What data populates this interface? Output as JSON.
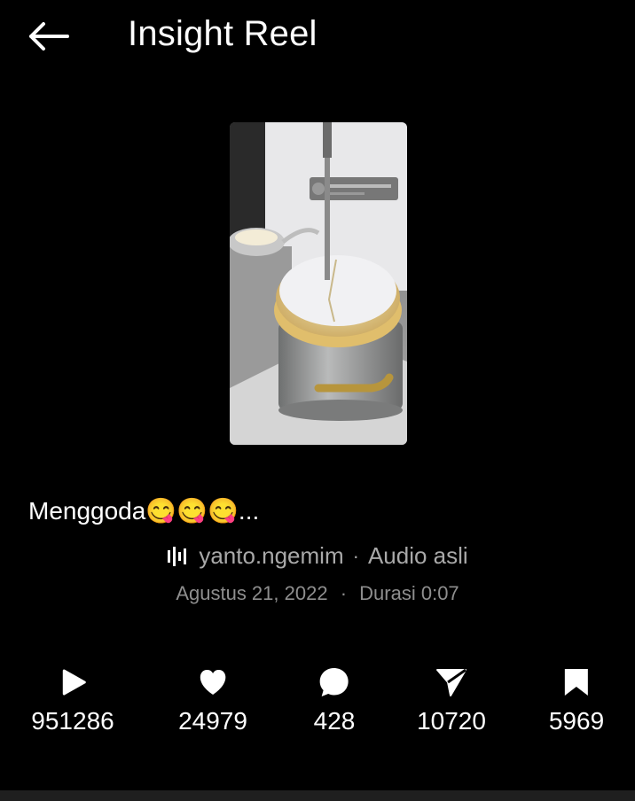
{
  "header": {
    "title": "Insight Reel",
    "back_icon": "arrow-left-icon"
  },
  "reel": {
    "thumbnail": "soufflé-video-thumbnail",
    "caption": "Menggoda😋😋😋..."
  },
  "audio": {
    "icon": "audio-waveform-icon",
    "username": "yanto.ngemim",
    "separator": "·",
    "label": "Audio asli"
  },
  "meta": {
    "date": "Agustus 21, 2022",
    "separator": "·",
    "duration": "Durasi 0:07"
  },
  "stats": {
    "plays": {
      "icon": "play-icon",
      "value": "951286"
    },
    "likes": {
      "icon": "heart-icon",
      "value": "24979"
    },
    "comments": {
      "icon": "comment-icon",
      "value": "428"
    },
    "shares": {
      "icon": "send-icon",
      "value": "10720"
    },
    "saves": {
      "icon": "bookmark-icon",
      "value": "5969"
    }
  },
  "colors": {
    "background": "#000000",
    "secondary_text": "#a9a9a9",
    "tertiary_text": "#8e8e8e"
  }
}
